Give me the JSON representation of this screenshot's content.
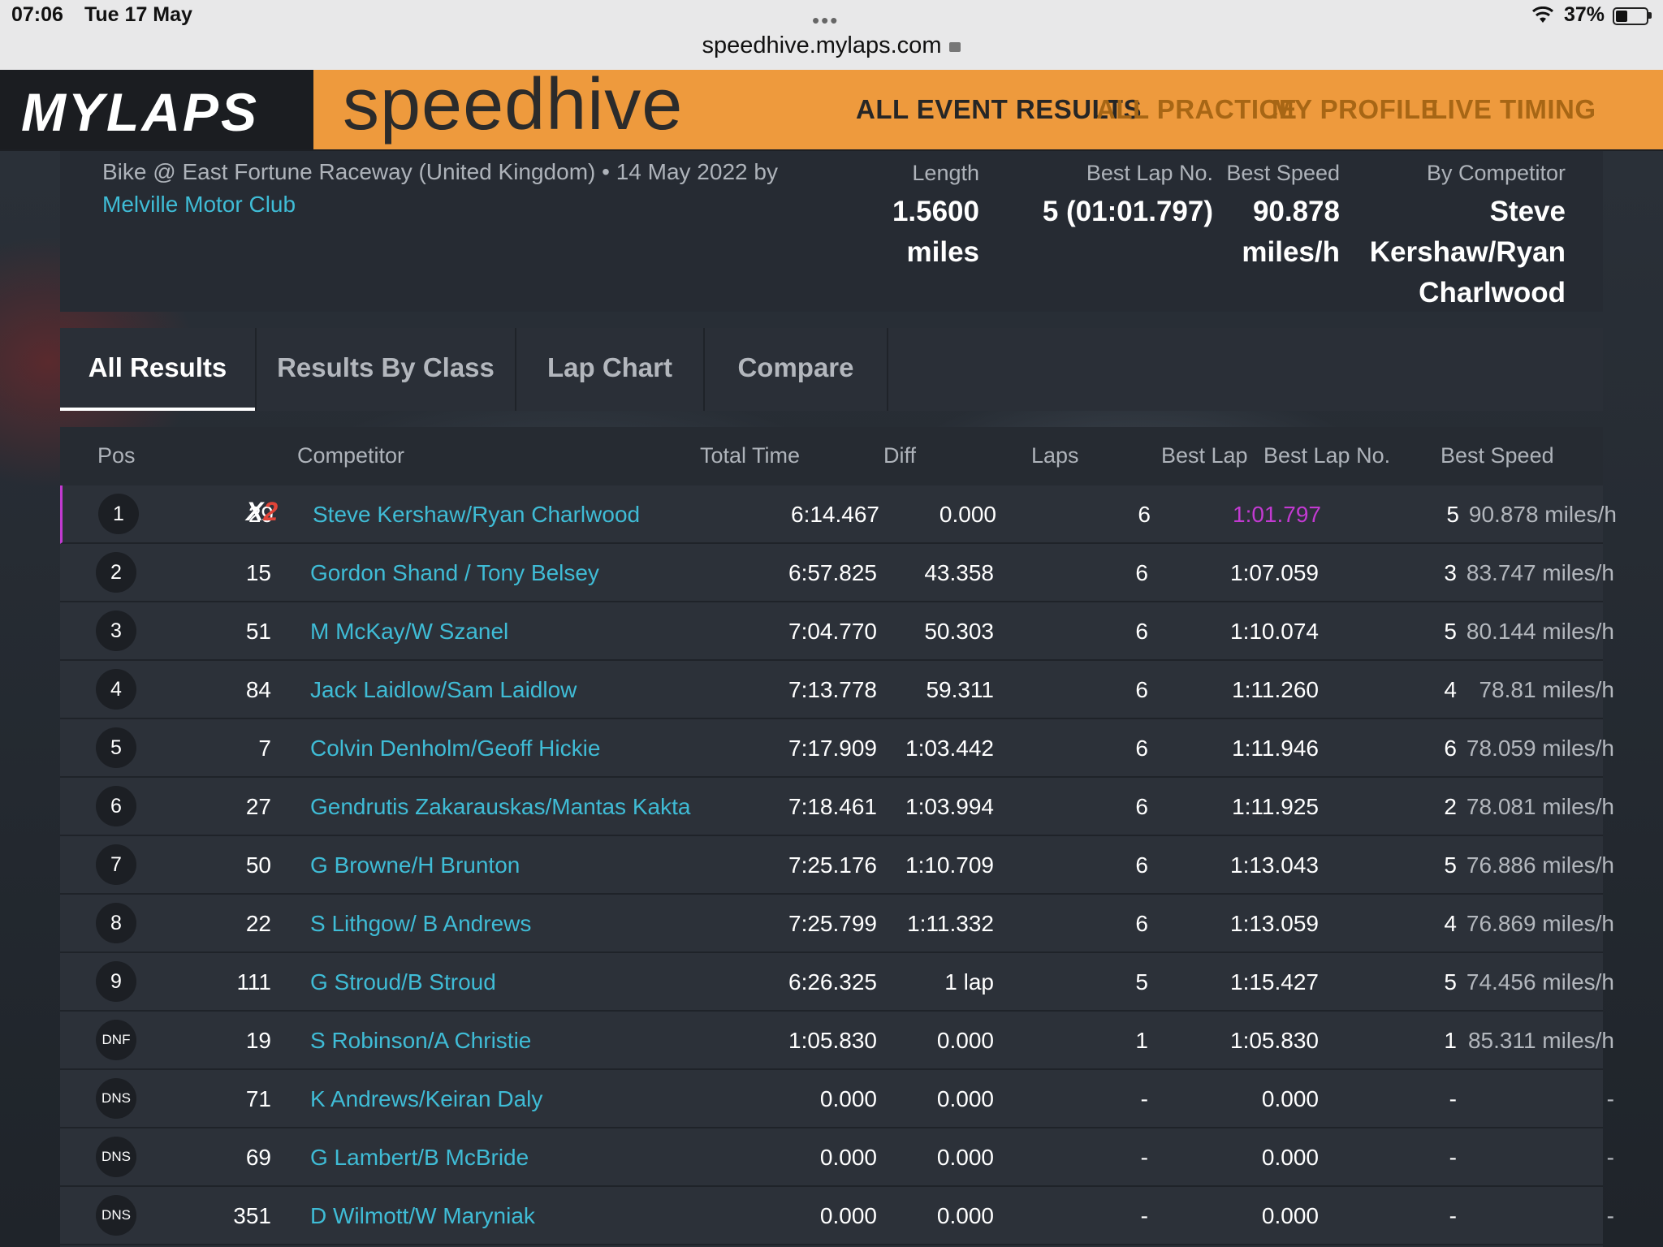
{
  "status": {
    "time": "07:06",
    "date": "Tue 17 May",
    "url": "speedhive.mylaps.com",
    "battery": "37%"
  },
  "header": {
    "logo": "MYLAPS",
    "brand": "speedhive",
    "nav": [
      "ALL EVENT RESULTS",
      "ALL PRACTICE",
      "MY PROFILE",
      "LIVE TIMING"
    ]
  },
  "event": {
    "description": "Bike @ East Fortune Raceway (United Kingdom) • 14 May 2022 by",
    "club": "Melville Motor Club",
    "stats": {
      "length_label": "Length",
      "length_value_1": "1.5600",
      "length_value_2": "miles",
      "bestlapno_label": "Best Lap No.",
      "bestlapno_value": "5 (01:01.797)",
      "bestspeed_label": "Best Speed",
      "bestspeed_value": "90.878 miles/h",
      "bycomp_label": "By Competitor",
      "bycomp_line1": "Steve",
      "bycomp_line2": "Kershaw/Ryan",
      "bycomp_line3": "Charlwood"
    }
  },
  "tabs": [
    "All Results",
    "Results By Class",
    "Lap Chart",
    "Compare"
  ],
  "table": {
    "headers": {
      "pos": "Pos",
      "competitor": "Competitor",
      "total_time": "Total Time",
      "diff": "Diff",
      "laps": "Laps",
      "best_lap": "Best Lap",
      "best_lap_no": "Best Lap No.",
      "best_speed": "Best Speed"
    },
    "x2_label_1": "X",
    "x2_label_2": "2",
    "rows": [
      {
        "pos": "1",
        "num": "29",
        "name": "Steve Kershaw/Ryan Charlwood",
        "total": "6:14.467",
        "diff": "0.000",
        "laps": "6",
        "best": "1:01.797",
        "lapno": "5",
        "speed": "90.878 miles/h"
      },
      {
        "pos": "2",
        "num": "15",
        "name": "Gordon Shand / Tony Belsey",
        "total": "6:57.825",
        "diff": "43.358",
        "laps": "6",
        "best": "1:07.059",
        "lapno": "3",
        "speed": "83.747 miles/h"
      },
      {
        "pos": "3",
        "num": "51",
        "name": "M McKay/W Szanel",
        "total": "7:04.770",
        "diff": "50.303",
        "laps": "6",
        "best": "1:10.074",
        "lapno": "5",
        "speed": "80.144 miles/h"
      },
      {
        "pos": "4",
        "num": "84",
        "name": "Jack Laidlow/Sam Laidlow",
        "total": "7:13.778",
        "diff": "59.311",
        "laps": "6",
        "best": "1:11.260",
        "lapno": "4",
        "speed": "78.81 miles/h"
      },
      {
        "pos": "5",
        "num": "7",
        "name": "Colvin Denholm/Geoff Hickie",
        "total": "7:17.909",
        "diff": "1:03.442",
        "laps": "6",
        "best": "1:11.946",
        "lapno": "6",
        "speed": "78.059 miles/h"
      },
      {
        "pos": "6",
        "num": "27",
        "name": "Gendrutis Zakarauskas/Mantas Kakta",
        "total": "7:18.461",
        "diff": "1:03.994",
        "laps": "6",
        "best": "1:11.925",
        "lapno": "2",
        "speed": "78.081 miles/h"
      },
      {
        "pos": "7",
        "num": "50",
        "name": "G Browne/H Brunton",
        "total": "7:25.176",
        "diff": "1:10.709",
        "laps": "6",
        "best": "1:13.043",
        "lapno": "5",
        "speed": "76.886 miles/h"
      },
      {
        "pos": "8",
        "num": "22",
        "name": "S Lithgow/ B Andrews",
        "total": "7:25.799",
        "diff": "1:11.332",
        "laps": "6",
        "best": "1:13.059",
        "lapno": "4",
        "speed": "76.869 miles/h"
      },
      {
        "pos": "9",
        "num": "111",
        "name": "G Stroud/B Stroud",
        "total": "6:26.325",
        "diff": "1 lap",
        "laps": "5",
        "best": "1:15.427",
        "lapno": "5",
        "speed": "74.456 miles/h"
      },
      {
        "pos": "DNF",
        "num": "19",
        "name": "S Robinson/A Christie",
        "total": "1:05.830",
        "diff": "0.000",
        "laps": "1",
        "best": "1:05.830",
        "lapno": "1",
        "speed": "85.311 miles/h"
      },
      {
        "pos": "DNS",
        "num": "71",
        "name": "K Andrews/Keiran Daly",
        "total": "0.000",
        "diff": "0.000",
        "laps": "-",
        "best": "0.000",
        "lapno": "-",
        "speed": "-"
      },
      {
        "pos": "DNS",
        "num": "69",
        "name": "G Lambert/B McBride",
        "total": "0.000",
        "diff": "0.000",
        "laps": "-",
        "best": "0.000",
        "lapno": "-",
        "speed": "-"
      },
      {
        "pos": "DNS",
        "num": "351",
        "name": "D Wilmott/W Maryniak",
        "total": "0.000",
        "diff": "0.000",
        "laps": "-",
        "best": "0.000",
        "lapno": "-",
        "speed": "-"
      }
    ]
  },
  "colors": {
    "accent": "#ee9a3d",
    "link": "#3fbcd6",
    "best_lap": "#c23ad1",
    "x2_red": "#e04438"
  }
}
